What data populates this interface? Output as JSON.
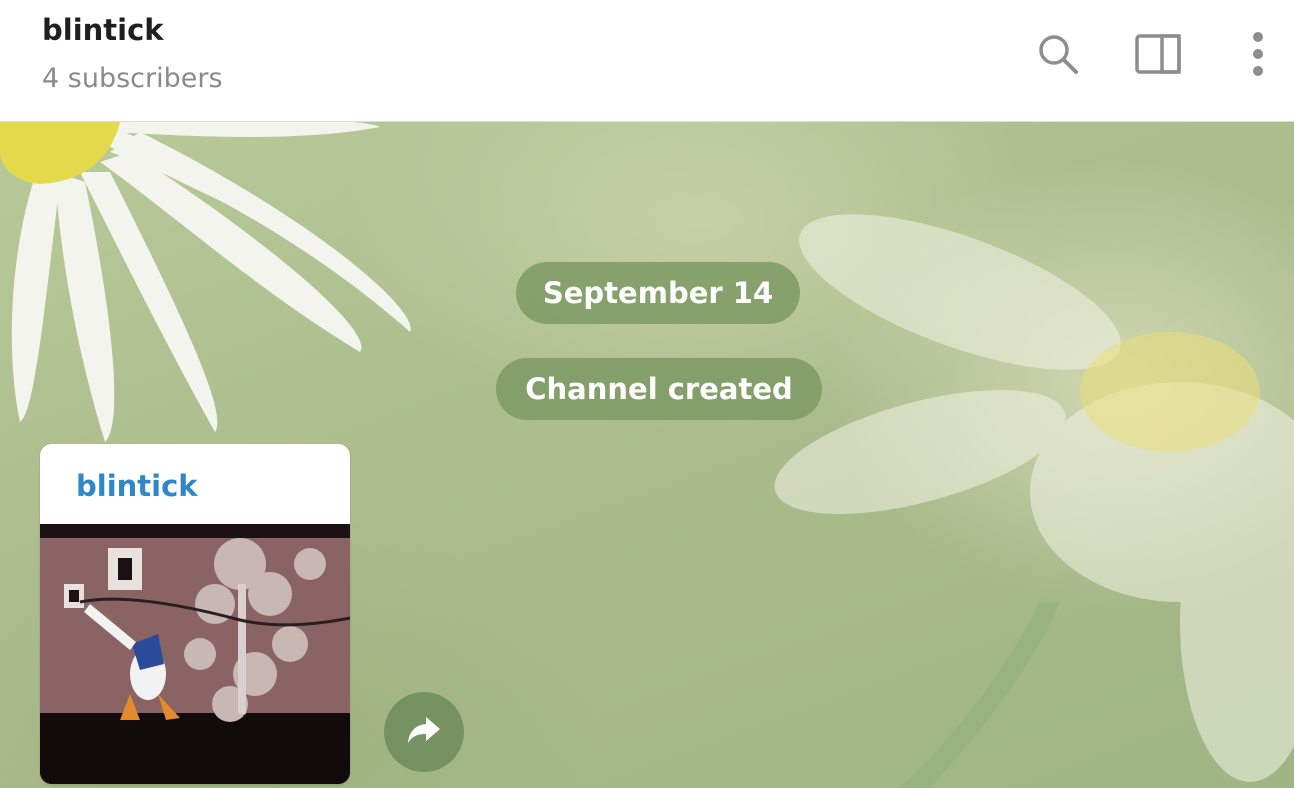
{
  "header": {
    "title": "blintick",
    "subtitle": "4 subscribers",
    "actions": [
      {
        "icon": "search-icon"
      },
      {
        "icon": "side-panel-icon"
      },
      {
        "icon": "more-vertical-icon"
      }
    ]
  },
  "chat": {
    "service_messages": {
      "date": "September 14",
      "created": "Channel created"
    },
    "message": {
      "author": "blintick",
      "media": "animated-gif"
    },
    "forward_icon": "forward-icon"
  },
  "colors": {
    "author": "#2f86c8",
    "pill": "#78965f",
    "header_bg": "#ffffff",
    "subtitle": "#8a8a8a"
  }
}
